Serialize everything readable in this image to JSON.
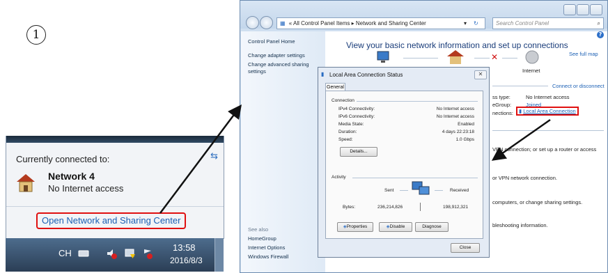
{
  "step_number": "1",
  "tray": {
    "currently_connected": "Currently connected to:",
    "network_name": "Network 4",
    "network_status": "No Internet access",
    "open_link": "Open Network and Sharing Center"
  },
  "taskbar": {
    "language": "CH",
    "time": "13:58",
    "date": "2016/8/3"
  },
  "window": {
    "breadcrumb": [
      "All Control Panel Items",
      "Network and Sharing Center"
    ],
    "search_placeholder": "Search Control Panel",
    "left_pane": {
      "home": "Control Panel Home",
      "adapter": "Change adapter settings",
      "advanced_line1": "Change advanced sharing",
      "advanced_line2": "settings",
      "see_also": "See also",
      "links": [
        "HomeGroup",
        "Internet Options",
        "Windows Firewall"
      ]
    },
    "main": {
      "heading": "View your basic network information and set up connections",
      "see_full_map": "See full map",
      "internet": "Internet",
      "connect_disconnect": "Connect or disconnect",
      "access_type_label": "ss type:",
      "access_type_value": "No Internet access",
      "homegroup_label": "eGroup:",
      "homegroup_value": "Joined",
      "connections_label": "nections:",
      "connections_value": "Local Area Connection",
      "text_vpn_router": "VPN connection; or set up a router or access",
      "text_vpn": "or VPN network connection.",
      "text_computers": "computers, or change sharing settings.",
      "text_troubleshoot": "bleshooting information."
    }
  },
  "dialog": {
    "title": "Local Area Connection Status",
    "tab": "General",
    "connection_label": "Connection",
    "rows": [
      {
        "label": "IPv4 Connectivity:",
        "value": "No Internet access"
      },
      {
        "label": "IPv6 Connectivity:",
        "value": "No Internet access"
      },
      {
        "label": "Media State:",
        "value": "Enabled"
      },
      {
        "label": "Duration:",
        "value": "4 days 22:23:18"
      },
      {
        "label": "Speed:",
        "value": "1.0 Gbps"
      }
    ],
    "details_button": "Details...",
    "activity_label": "Activity",
    "sent": "Sent",
    "received": "Received",
    "bytes_label": "Bytes:",
    "bytes_sent": "236,214,826",
    "bytes_received": "198,912,321",
    "properties_button": "Properties",
    "disable_button": "Disable",
    "diagnose_button": "Diagnose",
    "close_button": "Close"
  },
  "colors": {
    "link": "#1a5fb4",
    "highlight_box": "#e01010",
    "taskbar": "#3a5372"
  }
}
